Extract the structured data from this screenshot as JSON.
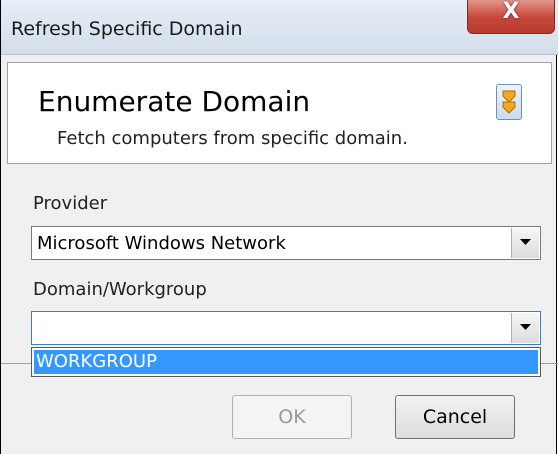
{
  "window": {
    "title": "Refresh Specific Domain",
    "close_glyph": "X"
  },
  "header": {
    "title": "Enumerate Domain",
    "subtitle": "Fetch computers from specific domain.",
    "icon": "refresh-arrows-icon"
  },
  "provider": {
    "label": "Provider",
    "value": "Microsoft Windows Network"
  },
  "domain": {
    "label": "Domain/Workgroup",
    "value": "",
    "options": [
      "WORKGROUP"
    ],
    "highlighted_option": "WORKGROUP"
  },
  "buttons": {
    "ok_label": "OK",
    "cancel_label": "Cancel"
  },
  "colors": {
    "highlight": "#3399ff",
    "close_button": "#c8493a"
  }
}
